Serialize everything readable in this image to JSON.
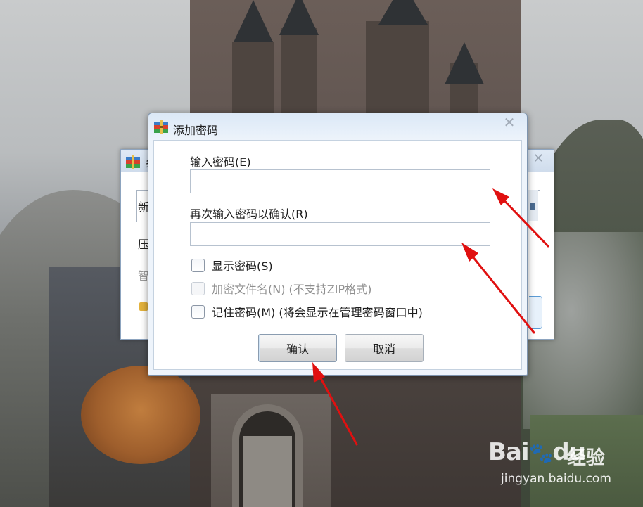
{
  "dialog": {
    "title": "添加密码",
    "close_glyph": "✕",
    "password_label": "输入密码(E)",
    "password_value": "",
    "confirm_label": "再次输入密码以确认(R)",
    "confirm_value": "",
    "options": {
      "show_password": {
        "label": "显示密码(S)",
        "checked": false,
        "enabled": true
      },
      "encrypt_filenames": {
        "label": "加密文件名(N) (不支持ZIP格式)",
        "checked": false,
        "enabled": false
      },
      "remember_password": {
        "label": "记住密码(M) (将会显示在管理密码窗口中)",
        "checked": false,
        "enabled": true
      }
    },
    "ok_label": "确认",
    "cancel_label": "取消"
  },
  "background_window": {
    "title_fragment": "乡",
    "close_glyph": "✕",
    "field_fragment_1": "新",
    "field_fragment_2": "压",
    "field_fragment_3": "智"
  },
  "watermark": {
    "brand": "Bai",
    "brand_suffix": "du",
    "brand_cn": "经验",
    "url": "jingyan.baidu.com"
  },
  "colors": {
    "arrow": "#e01010",
    "titlebar": "#dbe8f6",
    "dialog_border": "#7e94ae"
  }
}
